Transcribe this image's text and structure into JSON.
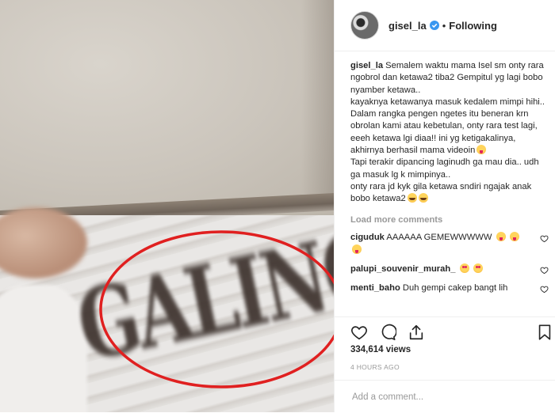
{
  "post": {
    "username": "gisel_la",
    "follow_status": "Following",
    "separator": "•"
  },
  "caption": {
    "author": "gisel_la",
    "lines": [
      "Semalem waktu mama Isel sm onty rara ngobrol dan ketawa2 tiba2 Gempitul yg lagi bobo nyamber ketawa..",
      "kayaknya ketawanya masuk kedalem mimpi hihi.. Dalam rangka pengen ngetes itu beneran krn obrolan kami atau kebetulan, onty rara test lagi, eeeh ketawa lgi diaa!! ini yg ketigakalinya, akhirnya berhasil mama videoin",
      "Tapi terakir dipancing laginudh ga mau dia.. udh ga masuk lg k mimpinya..",
      "onty rara jd kyk gila ketawa sndiri ngajak anak bobo ketawa2"
    ]
  },
  "load_more": "Load more comments",
  "comments": [
    {
      "user": "ciguduk",
      "text": "AAAAAA GEMEWWWWW"
    },
    {
      "user": "palupi_souvenir_murah_",
      "text": ""
    },
    {
      "user": "menti_baho",
      "text": "Duh gempi cakep bangt lih"
    }
  ],
  "stats": {
    "views": "334,614 views",
    "time_ago": "4 HOURS AGO"
  },
  "add_comment": {
    "placeholder": "Add a comment..."
  },
  "media": {
    "shirt_text": "GALING"
  },
  "icons": {
    "like": "heart-icon",
    "comment": "comment-bubble-icon",
    "share": "share-icon",
    "save": "bookmark-icon",
    "verified": "verified-badge-icon"
  },
  "colors": {
    "text": "#262626",
    "muted": "#999999",
    "verified": "#3897f0",
    "annotation": "#e02020"
  }
}
